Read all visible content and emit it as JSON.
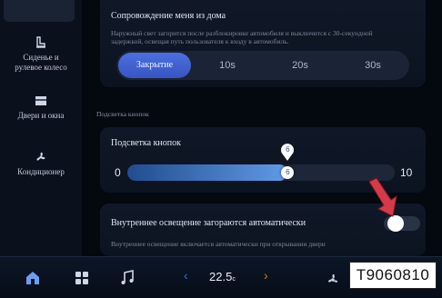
{
  "sidebar": {
    "items": [
      {
        "label_line1": "Сиденье и",
        "label_line2": "рулевое колесо",
        "icon": "seat-steering-icon"
      },
      {
        "label_line1": "Двери и окна",
        "label_line2": "",
        "icon": "door-icon"
      },
      {
        "label_line1": "Кондиционер",
        "label_line2": "",
        "icon": "fan-icon"
      }
    ]
  },
  "follow_me_home": {
    "title": "Сопровождение меня из дома",
    "description_line1": "Наружный свет загорится после разблокировке автомобиля и выключится с 30-секундной",
    "description_line2": "задержкой, освещая путь пользователя к входу в автомобиль.",
    "options": [
      "Закрытие",
      "10s",
      "20s",
      "30s"
    ],
    "selected": "Закрытие"
  },
  "button_backlight": {
    "section_label": "Подсветка кнопок",
    "title": "Подсветка кнопок",
    "min": "0",
    "max": "10",
    "value": 6,
    "value_label": "6",
    "bubble_label": "6"
  },
  "interior_lighting": {
    "title": "Внутреннее освещение загораются автоматически",
    "description": "Внутреннее освещение включается автоматически при открывании двери",
    "toggle_on": false
  },
  "bottom_bar": {
    "temperature": "22.5",
    "temperature_unit": "c",
    "icons": [
      "home-icon",
      "apps-grid-icon",
      "music-icon",
      "chevron-left-icon",
      "chevron-right-icon",
      "fan-icon"
    ]
  },
  "figure_code": "T9060810",
  "colors": {
    "accent": "#3d5fd0",
    "slider_fill": "#5f9be6",
    "arrow": "#d63a4a",
    "chevron_left": "#3a6bd8",
    "chevron_right": "#e0702a"
  }
}
